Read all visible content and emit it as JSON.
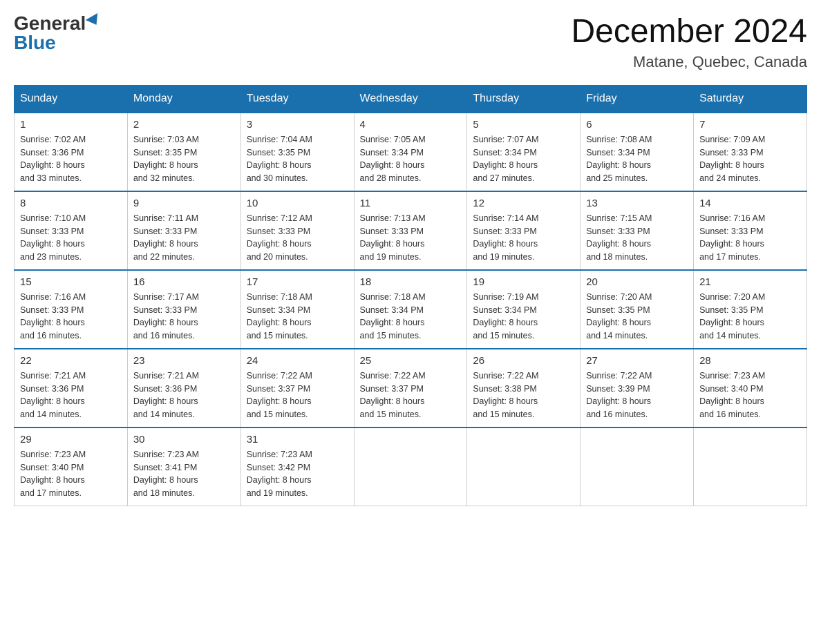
{
  "header": {
    "logo_general": "General",
    "logo_blue": "Blue",
    "title": "December 2024",
    "location": "Matane, Quebec, Canada"
  },
  "calendar": {
    "headers": [
      "Sunday",
      "Monday",
      "Tuesday",
      "Wednesday",
      "Thursday",
      "Friday",
      "Saturday"
    ],
    "weeks": [
      [
        {
          "day": "1",
          "sunrise": "Sunrise: 7:02 AM",
          "sunset": "Sunset: 3:36 PM",
          "daylight": "Daylight: 8 hours",
          "daylight2": "and 33 minutes."
        },
        {
          "day": "2",
          "sunrise": "Sunrise: 7:03 AM",
          "sunset": "Sunset: 3:35 PM",
          "daylight": "Daylight: 8 hours",
          "daylight2": "and 32 minutes."
        },
        {
          "day": "3",
          "sunrise": "Sunrise: 7:04 AM",
          "sunset": "Sunset: 3:35 PM",
          "daylight": "Daylight: 8 hours",
          "daylight2": "and 30 minutes."
        },
        {
          "day": "4",
          "sunrise": "Sunrise: 7:05 AM",
          "sunset": "Sunset: 3:34 PM",
          "daylight": "Daylight: 8 hours",
          "daylight2": "and 28 minutes."
        },
        {
          "day": "5",
          "sunrise": "Sunrise: 7:07 AM",
          "sunset": "Sunset: 3:34 PM",
          "daylight": "Daylight: 8 hours",
          "daylight2": "and 27 minutes."
        },
        {
          "day": "6",
          "sunrise": "Sunrise: 7:08 AM",
          "sunset": "Sunset: 3:34 PM",
          "daylight": "Daylight: 8 hours",
          "daylight2": "and 25 minutes."
        },
        {
          "day": "7",
          "sunrise": "Sunrise: 7:09 AM",
          "sunset": "Sunset: 3:33 PM",
          "daylight": "Daylight: 8 hours",
          "daylight2": "and 24 minutes."
        }
      ],
      [
        {
          "day": "8",
          "sunrise": "Sunrise: 7:10 AM",
          "sunset": "Sunset: 3:33 PM",
          "daylight": "Daylight: 8 hours",
          "daylight2": "and 23 minutes."
        },
        {
          "day": "9",
          "sunrise": "Sunrise: 7:11 AM",
          "sunset": "Sunset: 3:33 PM",
          "daylight": "Daylight: 8 hours",
          "daylight2": "and 22 minutes."
        },
        {
          "day": "10",
          "sunrise": "Sunrise: 7:12 AM",
          "sunset": "Sunset: 3:33 PM",
          "daylight": "Daylight: 8 hours",
          "daylight2": "and 20 minutes."
        },
        {
          "day": "11",
          "sunrise": "Sunrise: 7:13 AM",
          "sunset": "Sunset: 3:33 PM",
          "daylight": "Daylight: 8 hours",
          "daylight2": "and 19 minutes."
        },
        {
          "day": "12",
          "sunrise": "Sunrise: 7:14 AM",
          "sunset": "Sunset: 3:33 PM",
          "daylight": "Daylight: 8 hours",
          "daylight2": "and 19 minutes."
        },
        {
          "day": "13",
          "sunrise": "Sunrise: 7:15 AM",
          "sunset": "Sunset: 3:33 PM",
          "daylight": "Daylight: 8 hours",
          "daylight2": "and 18 minutes."
        },
        {
          "day": "14",
          "sunrise": "Sunrise: 7:16 AM",
          "sunset": "Sunset: 3:33 PM",
          "daylight": "Daylight: 8 hours",
          "daylight2": "and 17 minutes."
        }
      ],
      [
        {
          "day": "15",
          "sunrise": "Sunrise: 7:16 AM",
          "sunset": "Sunset: 3:33 PM",
          "daylight": "Daylight: 8 hours",
          "daylight2": "and 16 minutes."
        },
        {
          "day": "16",
          "sunrise": "Sunrise: 7:17 AM",
          "sunset": "Sunset: 3:33 PM",
          "daylight": "Daylight: 8 hours",
          "daylight2": "and 16 minutes."
        },
        {
          "day": "17",
          "sunrise": "Sunrise: 7:18 AM",
          "sunset": "Sunset: 3:34 PM",
          "daylight": "Daylight: 8 hours",
          "daylight2": "and 15 minutes."
        },
        {
          "day": "18",
          "sunrise": "Sunrise: 7:18 AM",
          "sunset": "Sunset: 3:34 PM",
          "daylight": "Daylight: 8 hours",
          "daylight2": "and 15 minutes."
        },
        {
          "day": "19",
          "sunrise": "Sunrise: 7:19 AM",
          "sunset": "Sunset: 3:34 PM",
          "daylight": "Daylight: 8 hours",
          "daylight2": "and 15 minutes."
        },
        {
          "day": "20",
          "sunrise": "Sunrise: 7:20 AM",
          "sunset": "Sunset: 3:35 PM",
          "daylight": "Daylight: 8 hours",
          "daylight2": "and 14 minutes."
        },
        {
          "day": "21",
          "sunrise": "Sunrise: 7:20 AM",
          "sunset": "Sunset: 3:35 PM",
          "daylight": "Daylight: 8 hours",
          "daylight2": "and 14 minutes."
        }
      ],
      [
        {
          "day": "22",
          "sunrise": "Sunrise: 7:21 AM",
          "sunset": "Sunset: 3:36 PM",
          "daylight": "Daylight: 8 hours",
          "daylight2": "and 14 minutes."
        },
        {
          "day": "23",
          "sunrise": "Sunrise: 7:21 AM",
          "sunset": "Sunset: 3:36 PM",
          "daylight": "Daylight: 8 hours",
          "daylight2": "and 14 minutes."
        },
        {
          "day": "24",
          "sunrise": "Sunrise: 7:22 AM",
          "sunset": "Sunset: 3:37 PM",
          "daylight": "Daylight: 8 hours",
          "daylight2": "and 15 minutes."
        },
        {
          "day": "25",
          "sunrise": "Sunrise: 7:22 AM",
          "sunset": "Sunset: 3:37 PM",
          "daylight": "Daylight: 8 hours",
          "daylight2": "and 15 minutes."
        },
        {
          "day": "26",
          "sunrise": "Sunrise: 7:22 AM",
          "sunset": "Sunset: 3:38 PM",
          "daylight": "Daylight: 8 hours",
          "daylight2": "and 15 minutes."
        },
        {
          "day": "27",
          "sunrise": "Sunrise: 7:22 AM",
          "sunset": "Sunset: 3:39 PM",
          "daylight": "Daylight: 8 hours",
          "daylight2": "and 16 minutes."
        },
        {
          "day": "28",
          "sunrise": "Sunrise: 7:23 AM",
          "sunset": "Sunset: 3:40 PM",
          "daylight": "Daylight: 8 hours",
          "daylight2": "and 16 minutes."
        }
      ],
      [
        {
          "day": "29",
          "sunrise": "Sunrise: 7:23 AM",
          "sunset": "Sunset: 3:40 PM",
          "daylight": "Daylight: 8 hours",
          "daylight2": "and 17 minutes."
        },
        {
          "day": "30",
          "sunrise": "Sunrise: 7:23 AM",
          "sunset": "Sunset: 3:41 PM",
          "daylight": "Daylight: 8 hours",
          "daylight2": "and 18 minutes."
        },
        {
          "day": "31",
          "sunrise": "Sunrise: 7:23 AM",
          "sunset": "Sunset: 3:42 PM",
          "daylight": "Daylight: 8 hours",
          "daylight2": "and 19 minutes."
        },
        null,
        null,
        null,
        null
      ]
    ]
  }
}
